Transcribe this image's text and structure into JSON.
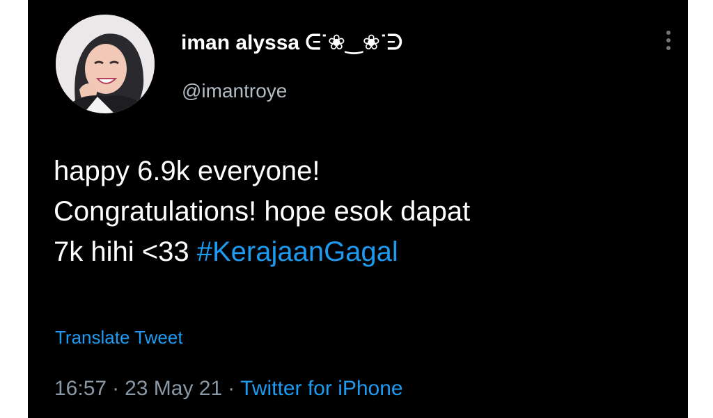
{
  "tweet": {
    "display_name": "iman alyssa ᕮ˙❀‿❀˙ᕭ",
    "handle": "@imantroye",
    "body": {
      "line1": "happy 6.9k everyone!",
      "line2": "Congratulations! hope esok dapat",
      "line3_text": "7k hihi <33 ",
      "hashtag": "#KerajaanGagal"
    },
    "translate_label": "Translate Tweet",
    "time": "16:57",
    "date": "23 May 21",
    "separator": "·",
    "source": "Twitter for iPhone"
  },
  "icons": {
    "more": "more-vertical-icon",
    "avatar": "profile-photo"
  },
  "colors": {
    "background": "#000000",
    "text": "#ffffff",
    "muted": "#8b98a5",
    "link": "#1d9bf0"
  }
}
